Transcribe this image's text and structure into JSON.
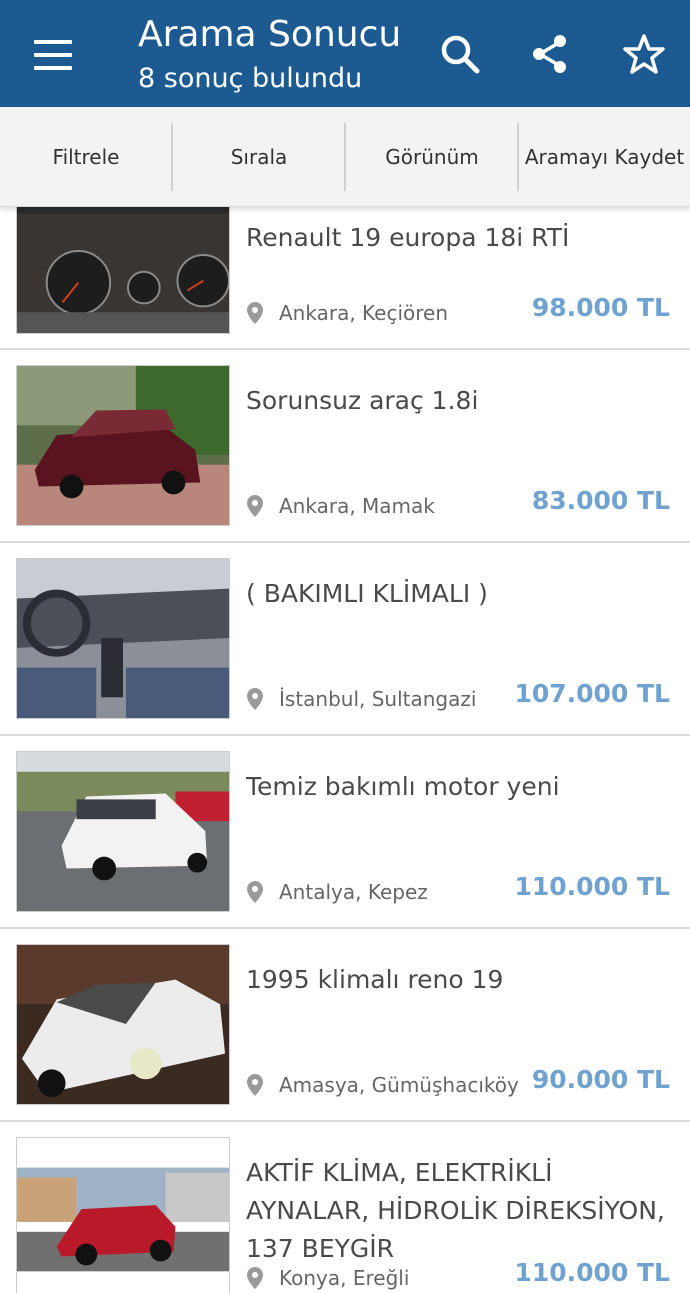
{
  "header": {
    "title": "Arama Sonucu",
    "subtitle": "8 sonuç bulundu",
    "background_color": "#1d5a92",
    "icons": [
      "menu-icon",
      "search-icon",
      "share-icon",
      "star-icon"
    ]
  },
  "toolbar": {
    "tabs": [
      {
        "label": "Filtrele"
      },
      {
        "label": "Sırala"
      },
      {
        "label": "Görünüm"
      },
      {
        "label": "Aramayı Kaydet"
      }
    ]
  },
  "listings": [
    {
      "title": "Renault 19 europa 18i RTİ",
      "location": "Ankara, Keçiören",
      "price": "98.000 TL"
    },
    {
      "title": "Sorunsuz araç 1.8i",
      "location": "Ankara, Mamak",
      "price": "83.000 TL"
    },
    {
      "title": "( BAKIMLI KLİMALI )",
      "location": "İstanbul, Sultangazi",
      "price": "107.000 TL"
    },
    {
      "title": "Temiz bakımlı motor yeni",
      "location": "Antalya, Kepez",
      "price": "110.000 TL"
    },
    {
      "title": "1995 klimalı reno 19",
      "location": "Amasya, Gümüşhacıköy",
      "price": "90.000 TL"
    },
    {
      "title": "AKTİF KLİMA, ELEKTRİKLİ AYNALAR, HİDROLİK DİREKSİYON, 137 BEYGİR",
      "location": "Konya, Ereğli",
      "price": "110.000 TL"
    }
  ],
  "colors": {
    "price": "#6fa2cf",
    "title_text": "#4a4a4a",
    "location_text": "#666666"
  }
}
